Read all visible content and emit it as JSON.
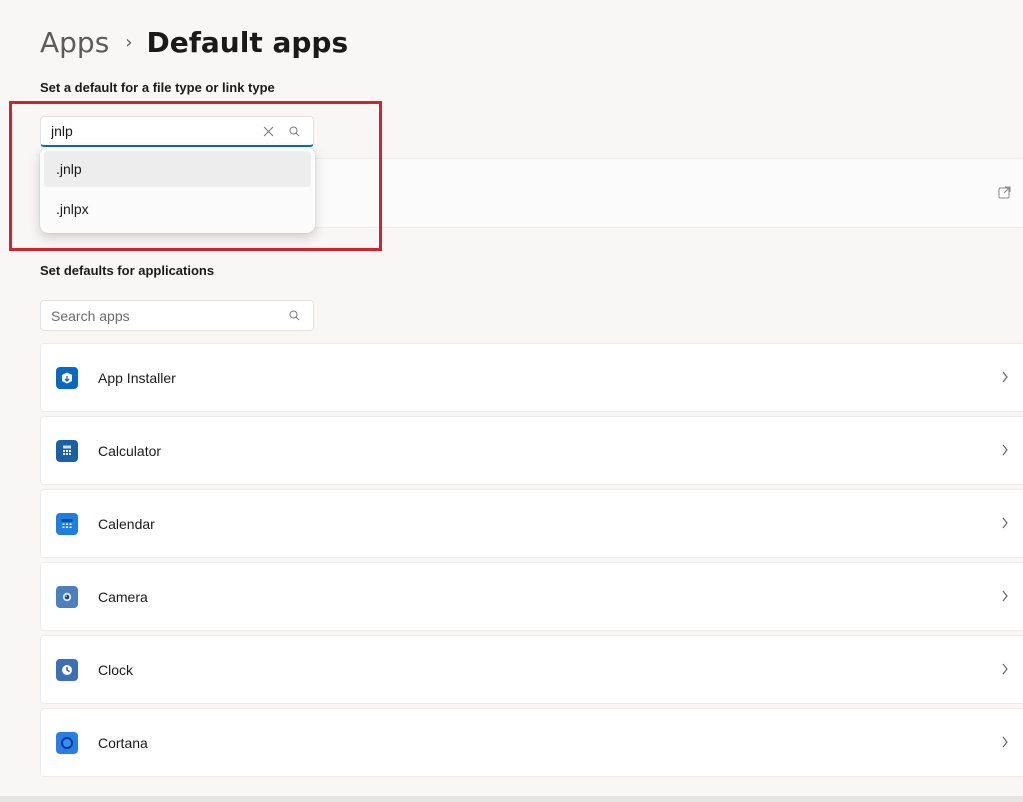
{
  "breadcrumb": {
    "parent": "Apps",
    "separator": "›",
    "current": "Default apps"
  },
  "file_type_section": {
    "label": "Set a default for a file type or link type",
    "search": {
      "value": "jnlp",
      "clear_icon": "close-icon",
      "search_icon": "search-icon"
    },
    "suggestions": [
      ".jnlp",
      ".jnlpx"
    ],
    "row_icon": "external-link-icon"
  },
  "apps_section": {
    "label": "Set defaults for applications",
    "search": {
      "placeholder": "Search apps",
      "search_icon": "search-icon"
    },
    "apps": [
      {
        "name": "App Installer",
        "icon": "app-installer-icon",
        "color": "#0a67c2"
      },
      {
        "name": "Calculator",
        "icon": "calculator-icon",
        "color": "#1b5fa8"
      },
      {
        "name": "Calendar",
        "icon": "calendar-icon",
        "color": "#1f7fe0"
      },
      {
        "name": "Camera",
        "icon": "camera-icon",
        "color": "#4a7fc0"
      },
      {
        "name": "Clock",
        "icon": "clock-icon",
        "color": "#3b6fb8"
      },
      {
        "name": "Cortana",
        "icon": "cortana-icon",
        "color": "#2a7ce8"
      }
    ]
  },
  "colors": {
    "accent": "#0f6cbd",
    "highlight_frame": "#d0232c",
    "background": "#f9f7f6"
  }
}
